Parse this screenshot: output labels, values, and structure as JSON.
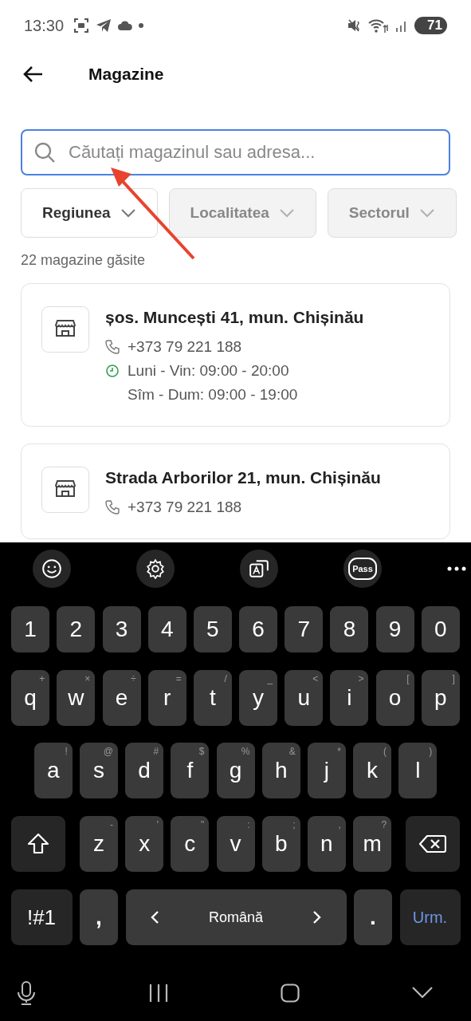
{
  "status_bar": {
    "time": "13:30",
    "battery": "71"
  },
  "app_bar": {
    "title": "Magazine"
  },
  "search": {
    "placeholder": "Căutați magazinul sau adresa...",
    "focused": true
  },
  "filters": [
    {
      "label": "Regiunea",
      "disabled": false
    },
    {
      "label": "Localitatea",
      "disabled": true
    },
    {
      "label": "Sectorul",
      "disabled": true
    }
  ],
  "result_count": "22 magazine găsite",
  "stores": [
    {
      "address": "șos. Muncești 41, mun. Chișinău",
      "phone": "+373 79 221 188",
      "hours": [
        "Luni - Vin: 09:00 - 20:00",
        "Sîm - Dum: 09:00 - 19:00"
      ]
    },
    {
      "address": "Strada Arborilor 21, mun. Chișinău",
      "phone": "+373 79 221 188"
    }
  ],
  "annotation": {
    "kind": "arrow"
  },
  "keyboard": {
    "toolbar": [
      {
        "kind": "emoji"
      },
      {
        "kind": "settings"
      },
      {
        "kind": "translate"
      },
      {
        "kind": "pass",
        "label": "Pass"
      },
      {
        "kind": "more"
      }
    ],
    "rows": [
      {
        "keys": [
          {
            "kind": "char",
            "label": "1"
          },
          {
            "kind": "char",
            "label": "2"
          },
          {
            "kind": "char",
            "label": "3"
          },
          {
            "kind": "char",
            "label": "4"
          },
          {
            "kind": "char",
            "label": "5"
          },
          {
            "kind": "char",
            "label": "6"
          },
          {
            "kind": "char",
            "label": "7"
          },
          {
            "kind": "char",
            "label": "8"
          },
          {
            "kind": "char",
            "label": "9"
          },
          {
            "kind": "char",
            "label": "0"
          }
        ]
      },
      {
        "keys": [
          {
            "kind": "char",
            "label": "q",
            "hint": "+"
          },
          {
            "kind": "char",
            "label": "w",
            "hint": "×"
          },
          {
            "kind": "char",
            "label": "e",
            "hint": "÷"
          },
          {
            "kind": "char",
            "label": "r",
            "hint": "="
          },
          {
            "kind": "char",
            "label": "t",
            "hint": "/"
          },
          {
            "kind": "char",
            "label": "y",
            "hint": "_"
          },
          {
            "kind": "char",
            "label": "u",
            "hint": "<"
          },
          {
            "kind": "char",
            "label": "i",
            "hint": ">"
          },
          {
            "kind": "char",
            "label": "o",
            "hint": "["
          },
          {
            "kind": "char",
            "label": "p",
            "hint": "]"
          }
        ]
      },
      {
        "keys": [
          {
            "kind": "char",
            "label": "a",
            "hint": "!"
          },
          {
            "kind": "char",
            "label": "s",
            "hint": "@"
          },
          {
            "kind": "char",
            "label": "d",
            "hint": "#"
          },
          {
            "kind": "char",
            "label": "f",
            "hint": "$"
          },
          {
            "kind": "char",
            "label": "g",
            "hint": "%"
          },
          {
            "kind": "char",
            "label": "h",
            "hint": "&"
          },
          {
            "kind": "char",
            "label": "j",
            "hint": "*"
          },
          {
            "kind": "char",
            "label": "k",
            "hint": "("
          },
          {
            "kind": "char",
            "label": "l",
            "hint": ")"
          }
        ]
      },
      {
        "keys": [
          {
            "kind": "shift"
          },
          {
            "kind": "char",
            "label": "z",
            "hint": "-"
          },
          {
            "kind": "char",
            "label": "x",
            "hint": "'"
          },
          {
            "kind": "char",
            "label": "c",
            "hint": "\""
          },
          {
            "kind": "char",
            "label": "v",
            "hint": ":"
          },
          {
            "kind": "char",
            "label": "b",
            "hint": ";"
          },
          {
            "kind": "char",
            "label": "n",
            "hint": ","
          },
          {
            "kind": "char",
            "label": "m",
            "hint": "?"
          },
          {
            "kind": "backspace"
          }
        ]
      },
      {
        "keys": [
          {
            "kind": "symbols",
            "label": "!#1"
          },
          {
            "kind": "comma",
            "label": ","
          },
          {
            "kind": "space",
            "label": "Română"
          },
          {
            "kind": "period",
            "label": "."
          },
          {
            "kind": "action",
            "label": "Urm."
          }
        ]
      }
    ]
  },
  "nav_bar": [
    {
      "kind": "mic"
    },
    {
      "kind": "recents"
    },
    {
      "kind": "home"
    },
    {
      "kind": "hide"
    }
  ]
}
